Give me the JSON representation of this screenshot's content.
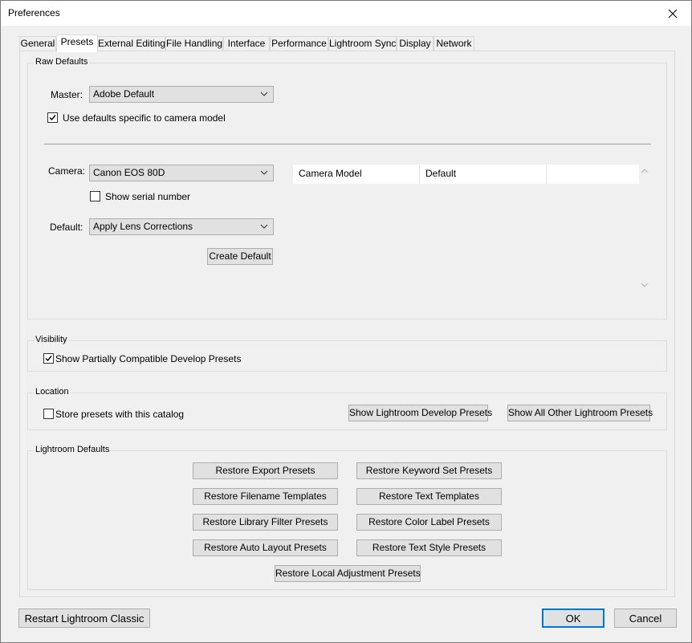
{
  "window": {
    "title": "Preferences"
  },
  "tabs": [
    {
      "label": "General"
    },
    {
      "label": "Presets"
    },
    {
      "label": "External Editing"
    },
    {
      "label": "File Handling"
    },
    {
      "label": "Interface"
    },
    {
      "label": "Performance"
    },
    {
      "label": "Lightroom Sync"
    },
    {
      "label": "Display"
    },
    {
      "label": "Network"
    }
  ],
  "active_tab": "Presets",
  "raw_defaults": {
    "group_label": "Raw Defaults",
    "master_label": "Master:",
    "master_value": "Adobe Default",
    "use_camera_defaults_label": "Use defaults specific to camera model",
    "use_camera_defaults_checked": true,
    "camera_label": "Camera:",
    "camera_value": "Canon EOS 80D",
    "show_serial_label": "Show serial number",
    "show_serial_checked": false,
    "default_label": "Default:",
    "default_value": "Apply Lens Corrections",
    "create_default_label": "Create Default",
    "table": {
      "columns": [
        "Camera Model",
        "Default"
      ],
      "rows": []
    }
  },
  "visibility": {
    "group_label": "Visibility",
    "show_partially_label": "Show Partially Compatible Develop Presets",
    "show_partially_checked": true
  },
  "location": {
    "group_label": "Location",
    "store_presets_label": "Store presets with this catalog",
    "store_presets_checked": false,
    "show_develop_presets_label": "Show Lightroom Develop Presets",
    "show_other_presets_label": "Show All Other Lightroom Presets"
  },
  "lightroom_defaults": {
    "group_label": "Lightroom Defaults",
    "buttons": [
      "Restore Export Presets",
      "Restore Keyword Set Presets",
      "Restore Filename Templates",
      "Restore Text Templates",
      "Restore Library Filter Presets",
      "Restore Color Label Presets",
      "Restore Auto Layout Presets",
      "Restore Text Style Presets",
      "Restore Local Adjustment Presets"
    ]
  },
  "footer": {
    "restart_label": "Restart Lightroom Classic",
    "ok_label": "OK",
    "cancel_label": "Cancel"
  },
  "colors": {
    "accent": "#0078d7",
    "dialog_bg": "#f0f0f0",
    "button_bg": "#e1e1e1"
  }
}
